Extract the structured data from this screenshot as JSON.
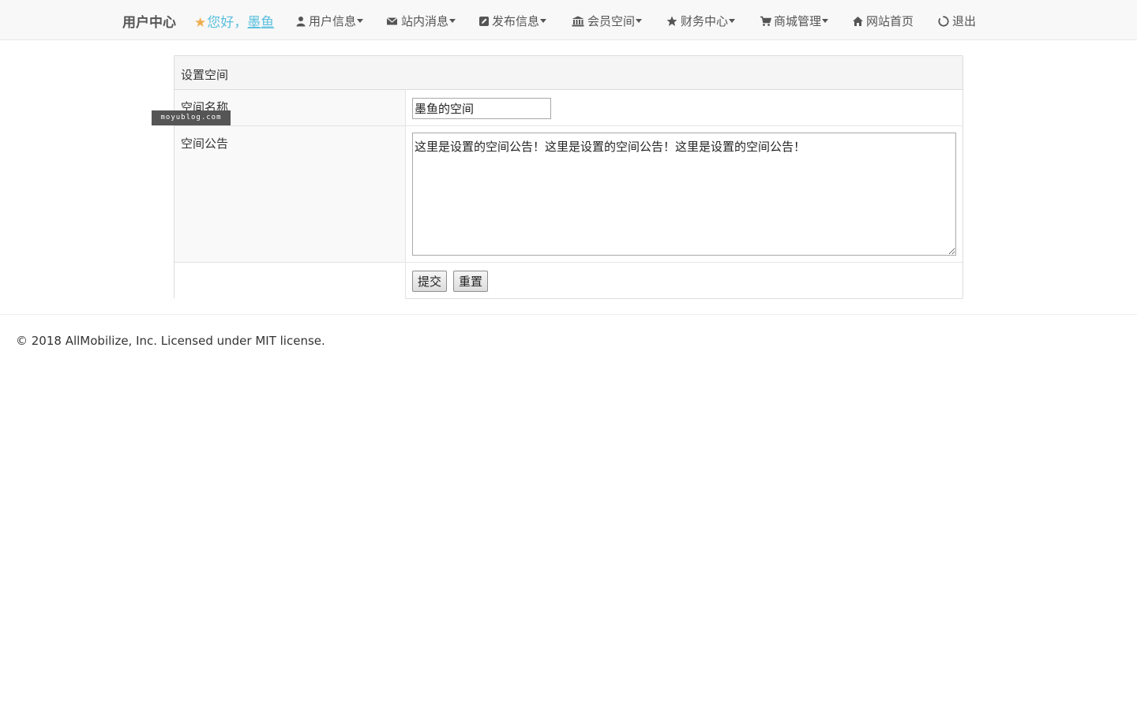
{
  "nav": {
    "brand": "用户中心",
    "greeting_prefix": "您好，",
    "username": "墨鱼",
    "items": [
      {
        "label": "用户信息",
        "icon": "user-icon",
        "dropdown": true
      },
      {
        "label": "站内消息",
        "icon": "envelope-icon",
        "dropdown": true
      },
      {
        "label": "发布信息",
        "icon": "edit-icon",
        "dropdown": true
      },
      {
        "label": "会员空间",
        "icon": "bank-icon",
        "dropdown": true
      },
      {
        "label": "财务中心",
        "icon": "star-icon",
        "dropdown": true
      },
      {
        "label": "商城管理",
        "icon": "cart-icon",
        "dropdown": true
      },
      {
        "label": "网站首页",
        "icon": "home-icon",
        "dropdown": false
      },
      {
        "label": "退出",
        "icon": "power-icon",
        "dropdown": false
      }
    ]
  },
  "panel": {
    "title": "设置空间",
    "space_name_label": "空间名称",
    "space_name_value": "墨鱼的空间",
    "notice_label": "空间公告",
    "notice_value": "这里是设置的空间公告！这里是设置的空间公告！这里是设置的空间公告！",
    "submit_label": "提交",
    "reset_label": "重置"
  },
  "watermark": "moyublog.com",
  "footer": {
    "text": "© 2018 AllMobilize, Inc. Licensed under MIT license."
  },
  "colors": {
    "accent": "#5bc0de",
    "star": "#f0ad4e",
    "nav_bg": "#f8f8f8",
    "nav_text": "#555555"
  }
}
